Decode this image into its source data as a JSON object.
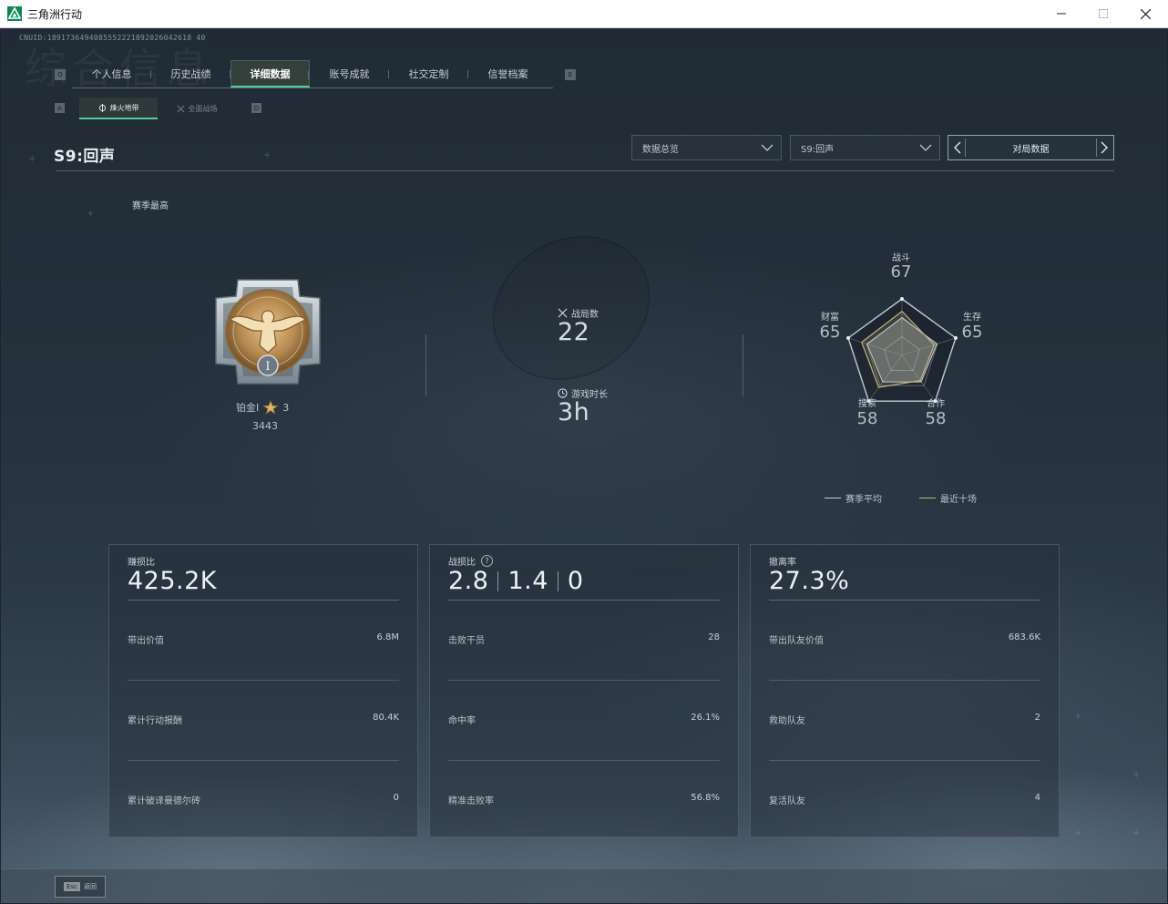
{
  "window": {
    "title": "三角洲行动",
    "controls": [
      "minimize",
      "maximize",
      "close"
    ]
  },
  "cnuid": "CNUID:1891736494085552221892026042618 40",
  "bg_heading": "综合信息",
  "tabs": {
    "left_key": "Q",
    "right_key": "E",
    "items": [
      "个人信息",
      "历史战绩",
      "详细数据",
      "账号成就",
      "社交定制",
      "信誉档案"
    ],
    "active_index": 2
  },
  "subtabs": {
    "left_key": "A",
    "right_key": "D",
    "items": [
      "烽火地带",
      "全面战场"
    ],
    "active_index": 0
  },
  "season": {
    "title": "S9:回声"
  },
  "filters": {
    "overview": "数据总览",
    "season_select": "S9:回声",
    "pager_label": "对局数据"
  },
  "rank": {
    "label": "赛季最高",
    "tier": "铂金I",
    "stars": "3",
    "score": "3443"
  },
  "matches": {
    "count_label": "战局数",
    "count": "22",
    "time_label": "游戏时长",
    "time": "3h"
  },
  "radar": {
    "axes": [
      {
        "name": "战斗",
        "value": 67
      },
      {
        "name": "生存",
        "value": 65
      },
      {
        "name": "合作",
        "value": 58
      },
      {
        "name": "搜索",
        "value": 58
      },
      {
        "name": "财富",
        "value": 65
      }
    ],
    "recent": [
      78,
      60,
      55,
      70,
      75
    ],
    "legend": {
      "season_avg": "赛季平均",
      "recent10": "最近十场"
    },
    "colors": {
      "season_avg": "#c8ced3",
      "recent10": "#c9b27a"
    }
  },
  "cards": [
    {
      "label": "赚损比",
      "value": "425.2K",
      "rows": [
        {
          "k": "带出价值",
          "v": "6.8M"
        },
        {
          "k": "累计行动报酬",
          "v": "80.4K"
        },
        {
          "k": "累计破译曼德尔砖",
          "v": "0"
        }
      ]
    },
    {
      "label": "战损比",
      "help": "?",
      "values": [
        "2.8",
        "1.4",
        "0"
      ],
      "rows": [
        {
          "k": "击败干员",
          "v": "28"
        },
        {
          "k": "命中率",
          "v": "26.1%"
        },
        {
          "k": "精准击败率",
          "v": "56.8%"
        }
      ]
    },
    {
      "label": "撤离率",
      "value": "27.3%",
      "rows": [
        {
          "k": "带出队友价值",
          "v": "683.6K"
        },
        {
          "k": "救助队友",
          "v": "2"
        },
        {
          "k": "复活队友",
          "v": "4"
        }
      ]
    }
  ],
  "footer": {
    "esc_key": "Esc",
    "back_label": "返回"
  },
  "accent": "#4fd29a"
}
